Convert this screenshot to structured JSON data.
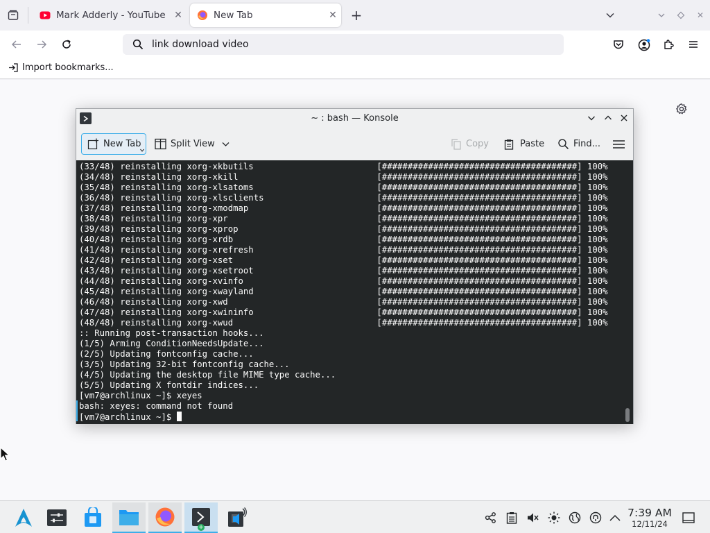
{
  "browser": {
    "tabs": [
      {
        "title": "Mark Adderly - YouTube",
        "active": false,
        "favicon": "youtube-icon"
      },
      {
        "title": "New Tab",
        "active": true,
        "favicon": "firefox-icon"
      }
    ],
    "url_bar_value": "link download video",
    "bookmarks": {
      "import_label": "Import bookmarks..."
    }
  },
  "konsole": {
    "title": "~ : bash — Konsole",
    "toolbar": {
      "new_tab": "New Tab",
      "split_view": "Split View",
      "copy": "Copy",
      "paste": "Paste",
      "find": "Find..."
    },
    "lines": [
      "(33/48) reinstalling xorg-xkbutils                        [######################################] 100%",
      "(34/48) reinstalling xorg-xkill                           [######################################] 100%",
      "(35/48) reinstalling xorg-xlsatoms                        [######################################] 100%",
      "(36/48) reinstalling xorg-xlsclients                      [######################################] 100%",
      "(37/48) reinstalling xorg-xmodmap                         [######################################] 100%",
      "(38/48) reinstalling xorg-xpr                             [######################################] 100%",
      "(39/48) reinstalling xorg-xprop                           [######################################] 100%",
      "(40/48) reinstalling xorg-xrdb                            [######################################] 100%",
      "(41/48) reinstalling xorg-xrefresh                        [######################################] 100%",
      "(42/48) reinstalling xorg-xset                            [######################################] 100%",
      "(43/48) reinstalling xorg-xsetroot                        [######################################] 100%",
      "(44/48) reinstalling xorg-xvinfo                          [######################################] 100%",
      "(45/48) reinstalling xorg-xwayland                        [######################################] 100%",
      "(46/48) reinstalling xorg-xwd                             [######################################] 100%",
      "(47/48) reinstalling xorg-xwininfo                        [######################################] 100%",
      "(48/48) reinstalling xorg-xwud                            [######################################] 100%",
      ":: Running post-transaction hooks...",
      "(1/5) Arming ConditionNeedsUpdate...",
      "(2/5) Updating fontconfig cache...",
      "(3/5) Updating 32-bit fontconfig cache...",
      "(4/5) Updating the desktop file MIME type cache...",
      "(5/5) Updating X fontdir indices...",
      "[vm7@archlinux ~]$ xeyes",
      "bash: xeyes: command not found",
      "[vm7@archlinux ~]$ "
    ]
  },
  "taskbar": {
    "apps": [
      {
        "name": "application-launcher",
        "icon": "arch-icon",
        "state": "none"
      },
      {
        "name": "system-settings",
        "icon": "settings-icon",
        "state": "none"
      },
      {
        "name": "discover",
        "icon": "store-icon",
        "state": "none"
      },
      {
        "name": "dolphin",
        "icon": "folder-icon",
        "state": "open"
      },
      {
        "name": "firefox",
        "icon": "firefox-icon",
        "state": "open"
      },
      {
        "name": "konsole",
        "icon": "terminal-icon",
        "state": "active"
      },
      {
        "name": "audio-app",
        "icon": "speaker-app-icon",
        "state": "none"
      }
    ],
    "clock": {
      "time": "7:39 AM",
      "date": "12/11/24"
    }
  },
  "colors": {
    "accent": "#3daee9",
    "terminal_bg": "#232627",
    "terminal_fg": "#fcfcfc",
    "youtube_red": "#ff0033",
    "firefox_orange": "#ff7139"
  }
}
